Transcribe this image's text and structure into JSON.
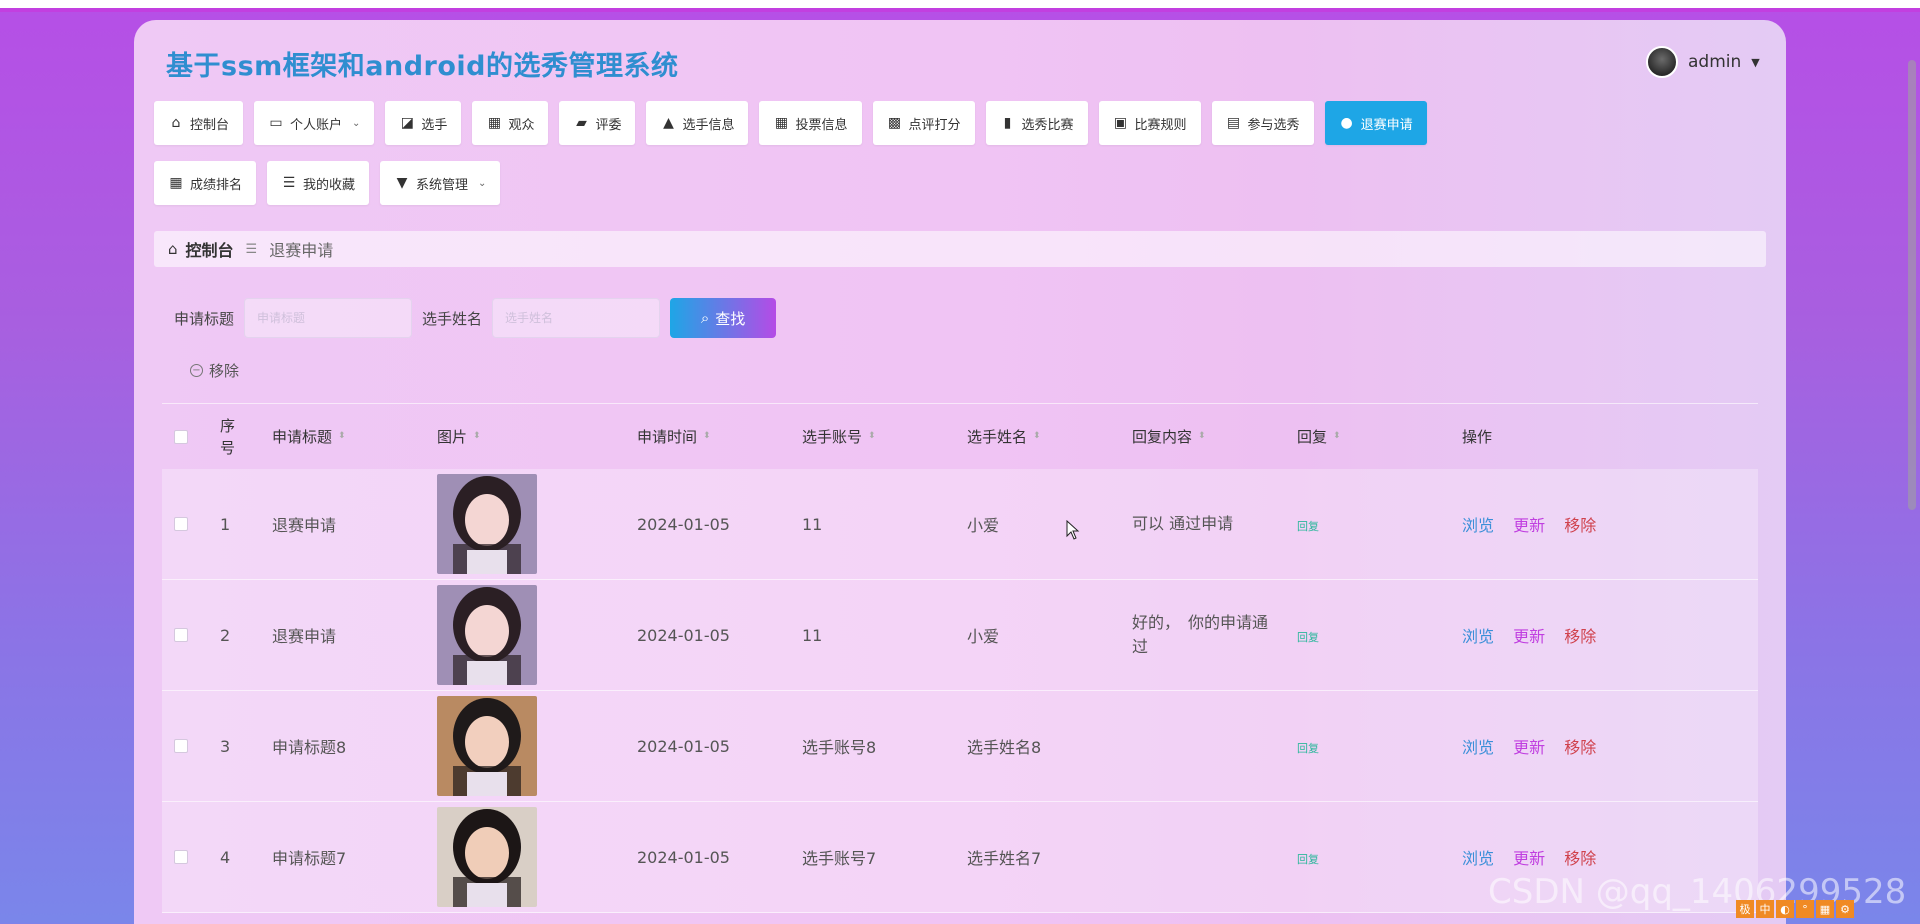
{
  "site_title": "基于ssm框架和android的选秀管理系统",
  "user": {
    "name": "admin"
  },
  "nav_row1": [
    {
      "label": "控制台",
      "icon": "home-icon",
      "glyph": "⌂"
    },
    {
      "label": "个人账户",
      "icon": "wallet-icon",
      "glyph": "▭",
      "dropdown": true
    },
    {
      "label": "选手",
      "icon": "chart-icon",
      "glyph": "◪"
    },
    {
      "label": "观众",
      "icon": "grid-icon",
      "glyph": "▦"
    },
    {
      "label": "评委",
      "icon": "wallet-icon",
      "glyph": "▰"
    },
    {
      "label": "选手信息",
      "icon": "user-icon",
      "glyph": "▲"
    },
    {
      "label": "投票信息",
      "icon": "grid-icon",
      "glyph": "▦"
    },
    {
      "label": "点评打分",
      "icon": "grid-icon",
      "glyph": "▩"
    },
    {
      "label": "选秀比赛",
      "icon": "bar-chart-icon",
      "glyph": "▮"
    },
    {
      "label": "比赛规则",
      "icon": "briefcase-icon",
      "glyph": "▣"
    },
    {
      "label": "参与选秀",
      "icon": "print-icon",
      "glyph": "▤"
    },
    {
      "label": "退赛申请",
      "icon": "location-icon",
      "glyph": "●",
      "active": true
    }
  ],
  "nav_row2": [
    {
      "label": "成绩排名",
      "icon": "grid-icon",
      "glyph": "▦"
    },
    {
      "label": "我的收藏",
      "icon": "sliders-icon",
      "glyph": "☰"
    },
    {
      "label": "系统管理",
      "icon": "brush-icon",
      "glyph": "▼",
      "dropdown": true
    }
  ],
  "breadcrumb": {
    "root": "控制台",
    "separator": "☰",
    "current": "退赛申请"
  },
  "search": {
    "title_label": "申请标题",
    "title_placeholder": "申请标题",
    "name_label": "选手姓名",
    "name_placeholder": "选手姓名",
    "button_label": "查找"
  },
  "remove_label": "移除",
  "table": {
    "headers": {
      "no": "序号",
      "title": "申请标题",
      "image": "图片",
      "time": "申请时间",
      "account": "选手账号",
      "name": "选手姓名",
      "reply_content": "回复内容",
      "reply": "回复",
      "ops": "操作"
    },
    "rows": [
      {
        "no": "1",
        "title": "退赛申请",
        "time": "2024-01-05",
        "account": "11",
        "name": "小爱",
        "reply_content": "可以 通过申请",
        "reply": "回复"
      },
      {
        "no": "2",
        "title": "退赛申请",
        "time": "2024-01-05",
        "account": "11",
        "name": "小爱",
        "reply_content": "好的，　你的申请通过",
        "reply": "回复"
      },
      {
        "no": "3",
        "title": "申请标题8",
        "time": "2024-01-05",
        "account": "选手账号8",
        "name": "选手姓名8",
        "reply_content": "",
        "reply": "回复"
      },
      {
        "no": "4",
        "title": "申请标题7",
        "time": "2024-01-05",
        "account": "选手账号7",
        "name": "选手姓名7",
        "reply_content": "",
        "reply": "回复"
      }
    ],
    "ops": {
      "view": "浏览",
      "update": "更新",
      "delete": "移除"
    }
  },
  "watermark": "CSDN @qq_1406299528",
  "colors": {
    "accent": "#1ea6e6",
    "title": "#2f8ed0",
    "view": "#3a8fd8",
    "update": "#c03fe0",
    "delete": "#d0424d",
    "reply": "#2bb79b"
  }
}
